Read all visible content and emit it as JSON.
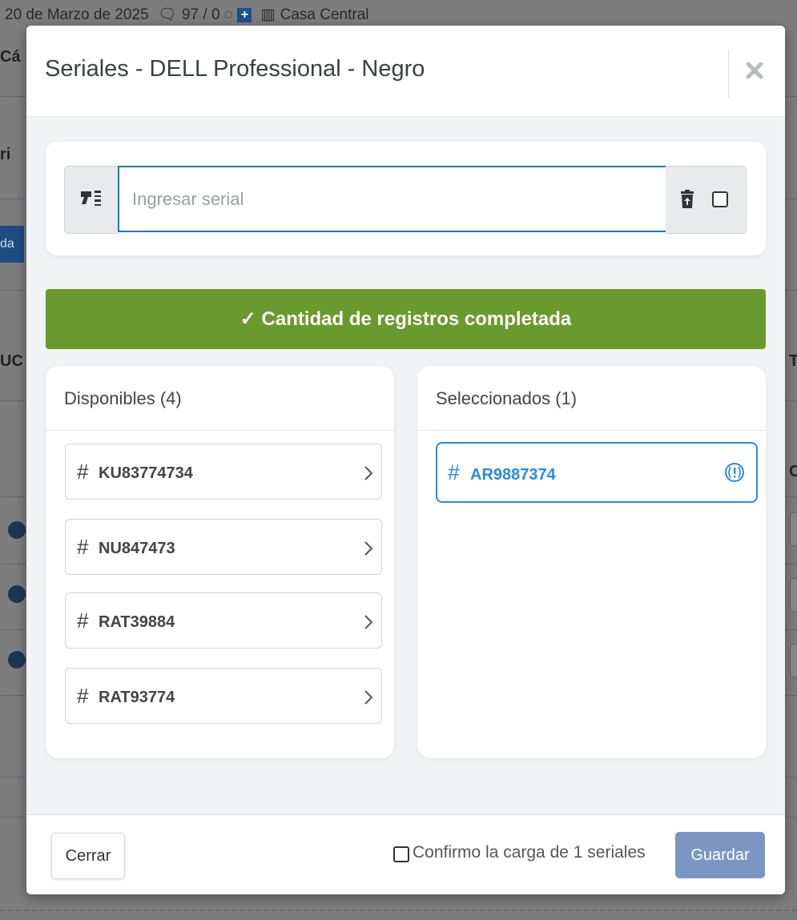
{
  "background": {
    "topbar_date": "20 de Marzo de 2025",
    "topbar_counts": "97 / 0",
    "topbar_branch": "Casa Central",
    "frag_1": "Cá",
    "frag_2": "ri",
    "frag_3": "UC",
    "frag_4": "T",
    "frag_5": "C",
    "side_button": "da"
  },
  "modal": {
    "title": "Seriales - DELL Professional - Negro",
    "close_icon": "close-icon"
  },
  "serial_input": {
    "placeholder": "Ingresar serial",
    "value": "",
    "scanner_icon": "barcode-scanner-icon",
    "trash_icon": "trash-restore-icon"
  },
  "banner": {
    "text": "✓ Cantidad de registros completada",
    "color": "#6a9a2e"
  },
  "available": {
    "title": "Disponibles (4)",
    "items": [
      {
        "hash": "#",
        "code": "KU83774734"
      },
      {
        "hash": "#",
        "code": "NU847473"
      },
      {
        "hash": "#",
        "code": "RAT39884"
      },
      {
        "hash": "#",
        "code": "RAT93774"
      }
    ]
  },
  "selected": {
    "title": "Seleccionados (1)",
    "items": [
      {
        "hash": "#",
        "code": "AR9887374",
        "icon": "alert-circle-icon"
      }
    ],
    "accent_color": "#2b8ae0"
  },
  "footer": {
    "close_label": "Cerrar",
    "confirm_label": "Confirmo la carga de 1 seriales",
    "save_label": "Guardar",
    "save_color": "#7c96c4"
  }
}
